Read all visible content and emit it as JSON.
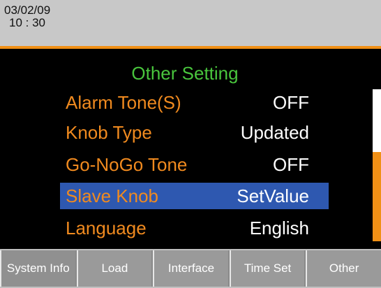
{
  "header": {
    "date": "03/02/09",
    "time": "10 : 30"
  },
  "menu": {
    "title": "Other Setting",
    "items": [
      {
        "label": "Alarm Tone(S)",
        "value": "OFF"
      },
      {
        "label": "Knob Type",
        "value": "Updated"
      },
      {
        "label": "Go-NoGo Tone",
        "value": "OFF"
      },
      {
        "label": "Slave Knob",
        "value": "SetValue",
        "selected": true
      },
      {
        "label": "Language",
        "value": "English"
      }
    ]
  },
  "softkeys": [
    {
      "label": "System Info"
    },
    {
      "label": "Load"
    },
    {
      "label": "Interface"
    },
    {
      "label": "Time Set"
    },
    {
      "label": "Other"
    }
  ],
  "colors": {
    "header_bg": "#c8c8c8",
    "accent": "#f09016",
    "title": "#49c53d",
    "label": "#f08a1f",
    "value": "#ffffff",
    "selected_bg": "#2e58b0"
  }
}
